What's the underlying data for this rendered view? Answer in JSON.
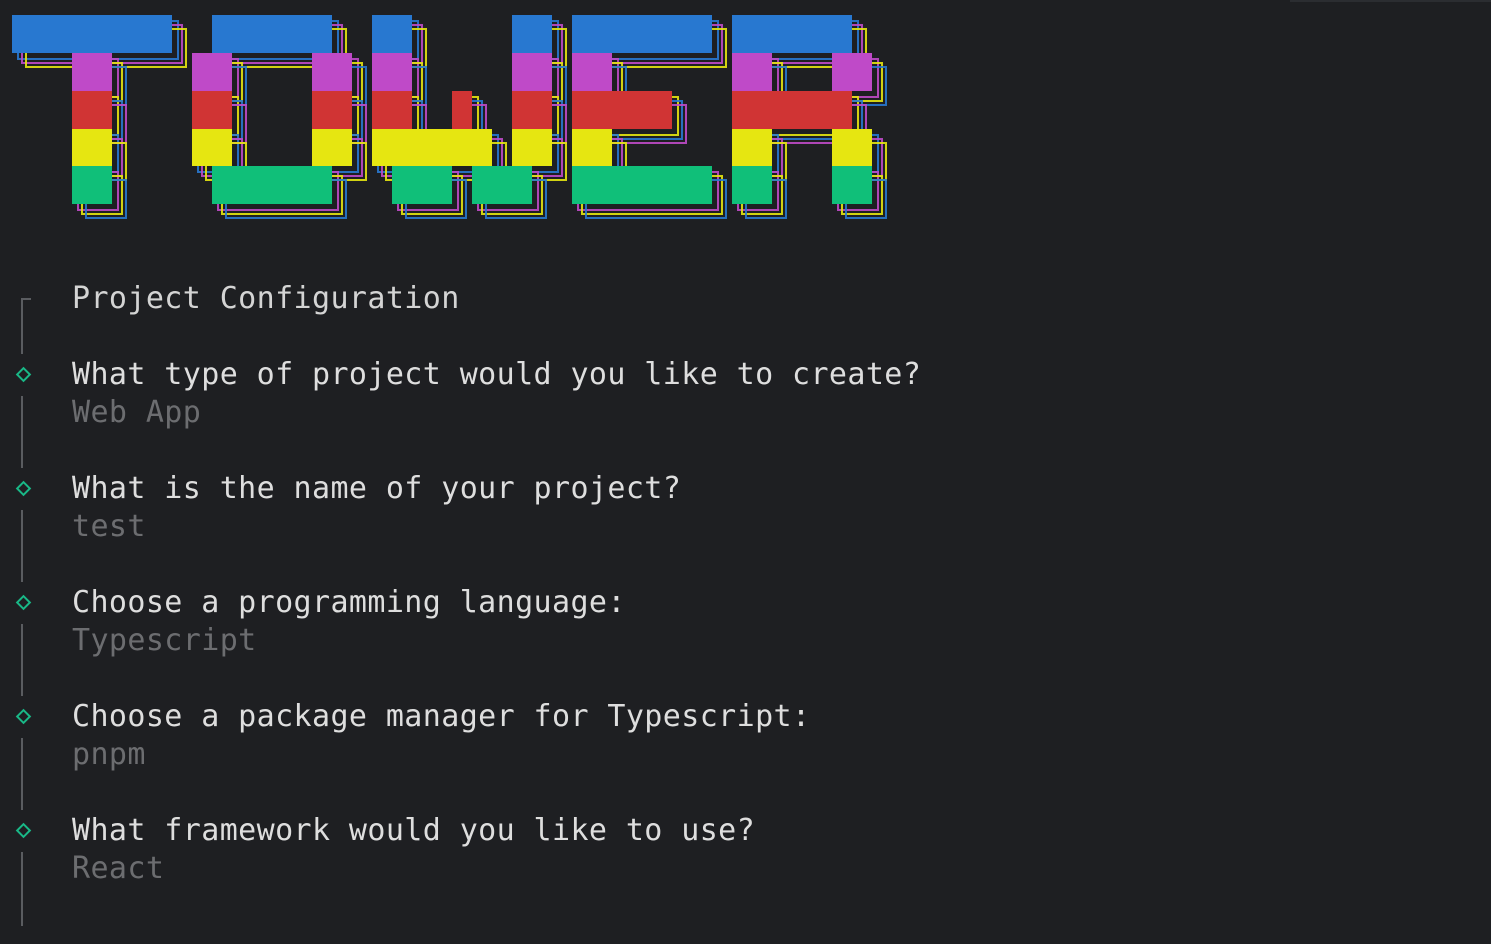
{
  "terminal": {
    "logo_text": "TOWER",
    "logo_colors": [
      "#2878d0",
      "#bf4ac8",
      "#d03434",
      "#e6e611",
      "#10bf79"
    ],
    "section_title": "Project Configuration",
    "accent_color": "#19b887",
    "steps": [
      {
        "question": "What type of project would you like to create?",
        "answer": "Web App"
      },
      {
        "question": "What is the name of your project?",
        "answer": "test"
      },
      {
        "question": "Choose a programming language:",
        "answer": "Typescript"
      },
      {
        "question": "Choose a package manager for Typescript:",
        "answer": "pnpm"
      },
      {
        "question": "What framework would you like to use?",
        "answer": "React"
      }
    ]
  }
}
